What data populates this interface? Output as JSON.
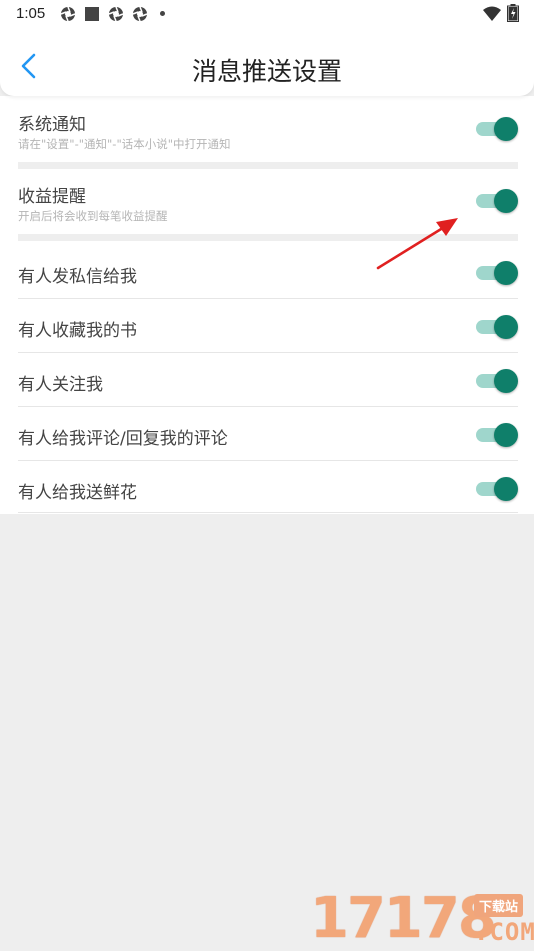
{
  "status_bar": {
    "time": "1:05"
  },
  "header": {
    "title": "消息推送设置"
  },
  "settings": [
    {
      "title": "系统通知",
      "subtitle": "请在\"设置\"-\"通知\"-\"话本小说\"中打开通知",
      "enabled": true
    },
    {
      "title": "收益提醒",
      "subtitle": "开启后将会收到每笔收益提醒",
      "enabled": true
    },
    {
      "title": "有人发私信给我",
      "enabled": true
    },
    {
      "title": "有人收藏我的书",
      "enabled": true
    },
    {
      "title": "有人关注我",
      "enabled": true
    },
    {
      "title": "有人给我评论/回复我的评论",
      "enabled": true
    },
    {
      "title": "有人给我送鲜花",
      "enabled": true
    }
  ],
  "watermark": {
    "number": "17178",
    "badge": "下载站",
    "suffix": ".COM"
  },
  "colors": {
    "accent": "#0f7f6a",
    "track": "#9fd6cc",
    "back_arrow": "#2196f3",
    "annotation_arrow": "#e02020"
  }
}
